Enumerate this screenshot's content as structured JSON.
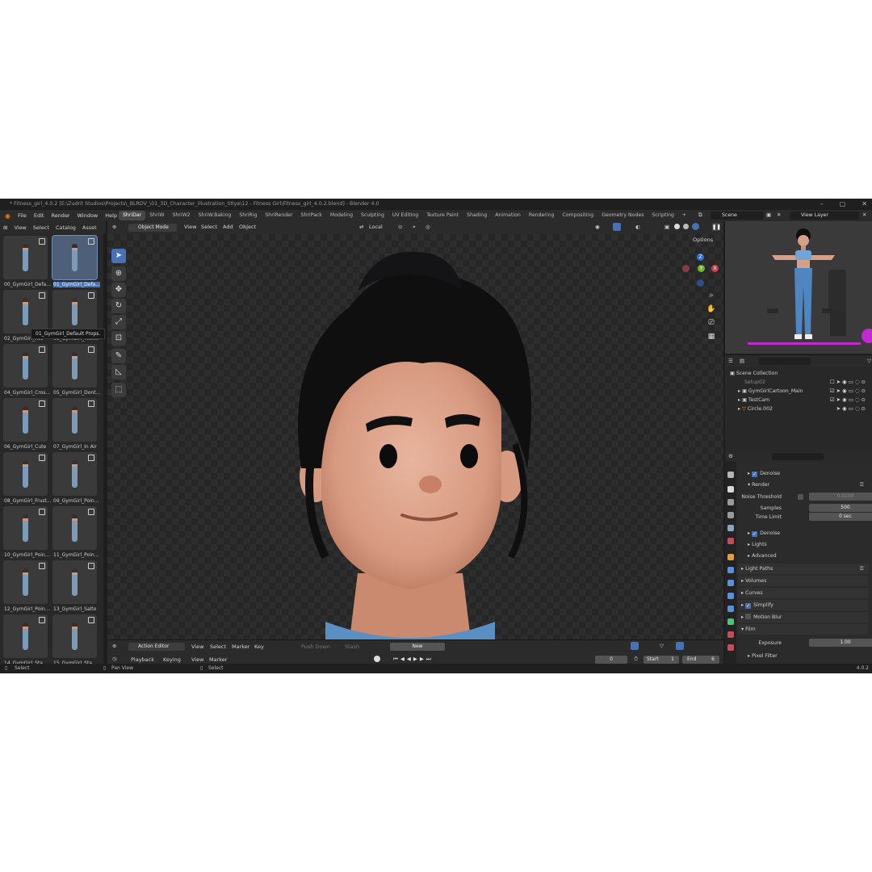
{
  "title": "* Fitness_girl_4.0.2 [E:\\Zudrit Studios\\Projects\\_BLRDV_\\01_3D_Character_Illustration_Stlye\\12 - Fitness Girl\\Fitness_girl_4.0.2.blend] - Blender 4.0",
  "menu": [
    "File",
    "Edit",
    "Render",
    "Window",
    "Help"
  ],
  "workspaces": [
    "ShriDar",
    "ShriW",
    "ShriW2",
    "ShriW.Baking",
    "ShriRig",
    "ShriRender",
    "ShriPack",
    "Modeling",
    "Sculpting",
    "UV Editing",
    "Texture Paint",
    "Shading",
    "Animation",
    "Rendering",
    "Compositing",
    "Geometry Nodes",
    "Scripting"
  ],
  "active_workspace": "ShriDar",
  "scene": "Scene",
  "view_layer": "View Layer",
  "asset_browser": {
    "menu": [
      "View",
      "Select",
      "Catalog",
      "Asset"
    ],
    "items": [
      "00_GymGirl_Defa...",
      "01_GymGirl_Defa...",
      "02_GymGirl_Act",
      "03_GymGirl_Thin...",
      "04_GymGirl_Cros...",
      "05_GymGirl_Dont...",
      "06_GymGirl_Cute",
      "07_GymGirl_In Air",
      "08_GymGirl_Frust...",
      "09_GymGirl_Poin...",
      "10_GymGirl_Poin...",
      "11_GymGirl_Poin...",
      "12_GymGirl_Poin...",
      "13_GymGirl_Salto",
      "14_GymGirl_Sta...",
      "15_GymGirl_Sta..."
    ],
    "tooltip": "01_GymGirl_Default Props."
  },
  "viewport": {
    "mode": "Object Mode",
    "menu": [
      "View",
      "Select",
      "Add",
      "Object"
    ],
    "orientation": "Local",
    "options": "Options",
    "gizmo_labels": [
      "Z",
      "Y",
      "X"
    ]
  },
  "action_editor": {
    "type": "Action Editor",
    "menu": [
      "View",
      "Select",
      "Marker",
      "Key"
    ],
    "push_down": "Push Down",
    "stash": "Stash",
    "new": "New"
  },
  "timeline": {
    "menu": [
      "Playback",
      "Keying",
      "View",
      "Marker"
    ],
    "current_frame": "0",
    "start_label": "Start",
    "start": "1",
    "end_label": "End",
    "end": "6"
  },
  "status": {
    "left": "Select",
    "middle": "Pan View",
    "right": "Select",
    "version": "4.0.2"
  },
  "outliner": {
    "root": "Scene Collection",
    "items": [
      "Setup02",
      "GymGirlCartoon_Main",
      "TestCam",
      "Circle.002"
    ]
  },
  "properties": {
    "denoise1": "Denoise",
    "render": "Render",
    "noise_threshold_label": "Noise Threshold",
    "noise_threshold": "0.0100",
    "samples_label": "Samples",
    "samples": "500",
    "time_limit_label": "Time Limit",
    "time_limit": "0 sec",
    "denoise2": "Denoise",
    "lights": "Lights",
    "advanced": "Advanced",
    "light_paths": "Light Paths",
    "volumes": "Volumes",
    "curves": "Curves",
    "simplify": "Simplify",
    "motion_blur": "Motion Blur",
    "film": "Film",
    "exposure_label": "Exposure",
    "exposure": "1.00",
    "pixel_filter": "Pixel Filter"
  }
}
